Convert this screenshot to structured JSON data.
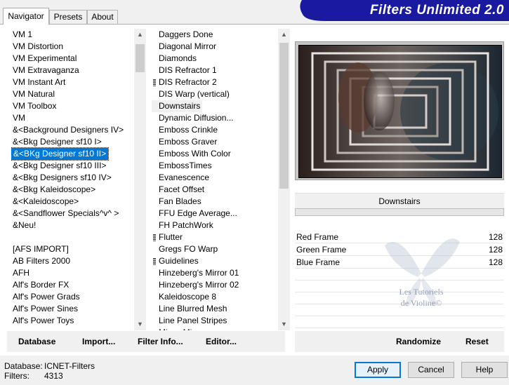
{
  "tabs": [
    {
      "label": "Navigator",
      "active": true
    },
    {
      "label": "Presets",
      "active": false
    },
    {
      "label": "About",
      "active": false
    }
  ],
  "app_title": "Filters Unlimited 2.0",
  "categories": [
    "VM 1",
    "VM Distortion",
    "VM Experimental",
    "VM Extravaganza",
    "VM Instant Art",
    "VM Natural",
    "VM Toolbox",
    "VM",
    "&<Background Designers IV>",
    "&<Bkg Designer sf10 I>",
    "&<BKg Designer sf10 II>",
    "&<Bkg Designer sf10 III>",
    "&<Bkg Designers sf10 IV>",
    "&<Bkg Kaleidoscope>",
    "&<Kaleidoscope>",
    "&<Sandflower Specials^v^ >",
    "&Neu!",
    "",
    "[AFS IMPORT]",
    "AB Filters 2000",
    "AFH",
    "Alf's Border FX",
    "Alf's Power Grads",
    "Alf's Power Sines",
    "Alf's Power Toys"
  ],
  "selected_category_index": 10,
  "filters": [
    {
      "label": "Daggers Done",
      "grip": false
    },
    {
      "label": "Diagonal Mirror",
      "grip": false
    },
    {
      "label": "Diamonds",
      "grip": false
    },
    {
      "label": "DIS Refractor 1",
      "grip": false
    },
    {
      "label": "DIS Refractor 2",
      "grip": true
    },
    {
      "label": "DIS Warp (vertical)",
      "grip": false
    },
    {
      "label": "Downstairs",
      "grip": false
    },
    {
      "label": "Dynamic Diffusion...",
      "grip": false
    },
    {
      "label": "Emboss Crinkle",
      "grip": false
    },
    {
      "label": "Emboss Graver",
      "grip": false
    },
    {
      "label": "Emboss With Color",
      "grip": false
    },
    {
      "label": "EmbossTimes",
      "grip": false
    },
    {
      "label": "Evanescence",
      "grip": false
    },
    {
      "label": "Facet Offset",
      "grip": false
    },
    {
      "label": "Fan Blades",
      "grip": false
    },
    {
      "label": "FFU Edge Average...",
      "grip": false
    },
    {
      "label": "FH PatchWork",
      "grip": false
    },
    {
      "label": "Flutter",
      "grip": true
    },
    {
      "label": "Gregs FO Warp",
      "grip": false
    },
    {
      "label": "Guidelines",
      "grip": true
    },
    {
      "label": "Hinzeberg's Mirror 01",
      "grip": false
    },
    {
      "label": "Hinzeberg's Mirror 02",
      "grip": false
    },
    {
      "label": "Kaleidoscope 8",
      "grip": false
    },
    {
      "label": "Line Blurred Mesh",
      "grip": false
    },
    {
      "label": "Line Panel Stripes",
      "grip": false
    },
    {
      "label": "Mirror Mirror",
      "grip": false
    }
  ],
  "current_filter_index": 6,
  "current_filter_name": "Downstairs",
  "params": [
    {
      "name": "Red Frame",
      "value": "128"
    },
    {
      "name": "Green Frame",
      "value": "128"
    },
    {
      "name": "Blue Frame",
      "value": "128"
    }
  ],
  "watermark": {
    "line1": "Les Tutoriels",
    "line2": "de Violine©"
  },
  "toolbar": {
    "database": "Database",
    "import": "Import...",
    "filter_info": "Filter Info...",
    "editor": "Editor...",
    "randomize": "Randomize",
    "reset": "Reset"
  },
  "status": {
    "database_label": "Database:",
    "database_value": "ICNET-Filters",
    "filters_label": "Filters:",
    "filters_value": "4313"
  },
  "buttons": {
    "apply": "Apply",
    "cancel": "Cancel",
    "help": "Help"
  },
  "colors": {
    "banner": "#1a1aa0",
    "selection": "#0078d7",
    "default_border": "#0078d7"
  }
}
